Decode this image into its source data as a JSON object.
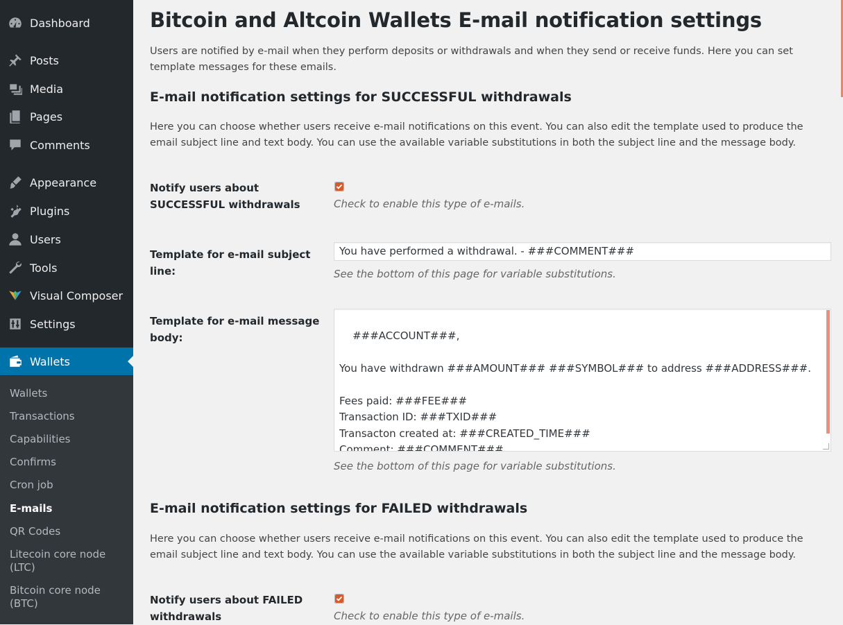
{
  "sidebar": {
    "items": [
      {
        "label": "Dashboard",
        "icon": "dashboard-icon"
      },
      {
        "label": "Posts",
        "icon": "pin-icon"
      },
      {
        "label": "Media",
        "icon": "media-icon"
      },
      {
        "label": "Pages",
        "icon": "pages-icon"
      },
      {
        "label": "Comments",
        "icon": "comments-icon"
      },
      {
        "label": "Appearance",
        "icon": "brush-icon"
      },
      {
        "label": "Plugins",
        "icon": "plug-icon"
      },
      {
        "label": "Users",
        "icon": "user-icon"
      },
      {
        "label": "Tools",
        "icon": "wrench-icon"
      },
      {
        "label": "Visual Composer",
        "icon": "visual-composer-icon"
      },
      {
        "label": "Settings",
        "icon": "settings-icon"
      },
      {
        "label": "Wallets",
        "icon": "wallet-icon"
      }
    ],
    "submenu": [
      "Wallets",
      "Transactions",
      "Capabilities",
      "Confirms",
      "Cron job",
      "E-mails",
      "QR Codes",
      "Litecoin core node (LTC)",
      "Bitcoin core node (BTC)"
    ],
    "active_color": "#0073aa",
    "background": "#23282d"
  },
  "page": {
    "title": "Bitcoin and Altcoin Wallets E-mail notification settings",
    "intro": "Users are notified by e-mail when they perform deposits or withdrawals and when they send or receive funds. Here you can set template messages for these emails."
  },
  "sections": [
    {
      "title": "E-mail notification settings for SUCCESSFUL withdrawals",
      "description": "Here you can choose whether users receive e-mail notifications on this event. You can also edit the template used to produce the email subject line and text body. You can use the available variable substitutions in both the subject line and the message body.",
      "notify_label": "Notify users about SUCCESSFUL withdrawals",
      "notify_checked": true,
      "notify_desc": "Check to enable this type of e-mails.",
      "subject_label": "Template for e-mail subject line:",
      "subject_value": "You have performed a withdrawal. - ###COMMENT###",
      "subject_desc": "See the bottom of this page for variable substitutions.",
      "body_label": "Template for e-mail message body:",
      "body_value": "###ACCOUNT###,\n\nYou have withdrawn ###AMOUNT### ###SYMBOL### to address ###ADDRESS###.\n\nFees paid: ###FEE###\nTransaction ID: ###TXID###\nTransacton created at: ###CREATED_TIME###\nComment: ###COMMENT###",
      "body_desc": "See the bottom of this page for variable substitutions."
    },
    {
      "title": "E-mail notification settings for FAILED withdrawals",
      "description": "Here you can choose whether users receive e-mail notifications on this event. You can also edit the template used to produce the email subject line and text body. You can use the available variable substitutions in both the subject line and the message body.",
      "notify_label": "Notify users about FAILED withdrawals",
      "notify_checked": true,
      "notify_desc": "Check to enable this type of e-mails."
    }
  ],
  "accent_color": "#d45c2c"
}
